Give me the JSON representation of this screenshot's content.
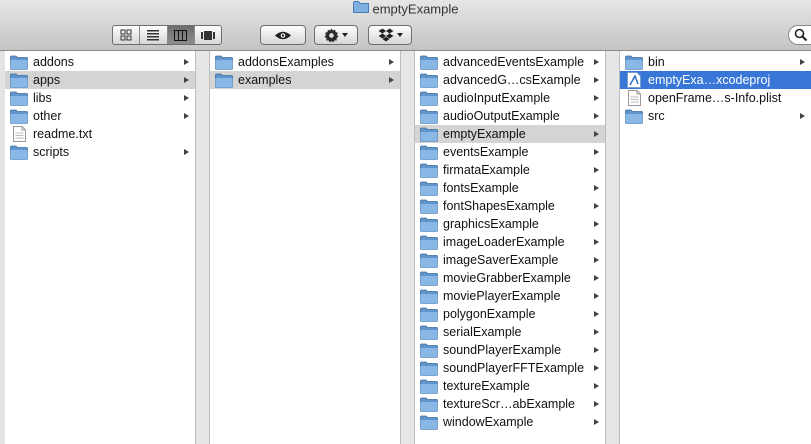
{
  "window": {
    "title": "emptyExample"
  },
  "toolbar": {
    "views": [
      {
        "name": "icon-view-button",
        "icon": "grid-icon"
      },
      {
        "name": "list-view-button",
        "icon": "list-icon"
      },
      {
        "name": "column-view-button",
        "icon": "columns-icon",
        "active": true
      },
      {
        "name": "coverflow-view-button",
        "icon": "coverflow-icon"
      }
    ]
  },
  "columns": [
    {
      "items": [
        {
          "label": "addons",
          "kind": "folder",
          "arrow": true
        },
        {
          "label": "apps",
          "kind": "folder",
          "arrow": true,
          "selected": "gray"
        },
        {
          "label": "libs",
          "kind": "folder",
          "arrow": true
        },
        {
          "label": "other",
          "kind": "folder",
          "arrow": true
        },
        {
          "label": "readme.txt",
          "kind": "file",
          "arrow": false
        },
        {
          "label": "scripts",
          "kind": "folder",
          "arrow": true
        }
      ]
    },
    {
      "items": [
        {
          "label": "addonsExamples",
          "kind": "folder",
          "arrow": true
        },
        {
          "label": "examples",
          "kind": "folder",
          "arrow": true,
          "selected": "gray"
        }
      ]
    },
    {
      "items": [
        {
          "label": "advancedEventsExample",
          "kind": "folder",
          "arrow": true
        },
        {
          "label": "advancedG…csExample",
          "kind": "folder",
          "arrow": true
        },
        {
          "label": "audioInputExample",
          "kind": "folder",
          "arrow": true
        },
        {
          "label": "audioOutputExample",
          "kind": "folder",
          "arrow": true
        },
        {
          "label": "emptyExample",
          "kind": "folder",
          "arrow": true,
          "selected": "gray"
        },
        {
          "label": "eventsExample",
          "kind": "folder",
          "arrow": true
        },
        {
          "label": "firmataExample",
          "kind": "folder",
          "arrow": true
        },
        {
          "label": "fontsExample",
          "kind": "folder",
          "arrow": true
        },
        {
          "label": "fontShapesExample",
          "kind": "folder",
          "arrow": true
        },
        {
          "label": "graphicsExample",
          "kind": "folder",
          "arrow": true
        },
        {
          "label": "imageLoaderExample",
          "kind": "folder",
          "arrow": true
        },
        {
          "label": "imageSaverExample",
          "kind": "folder",
          "arrow": true
        },
        {
          "label": "movieGrabberExample",
          "kind": "folder",
          "arrow": true
        },
        {
          "label": "moviePlayerExample",
          "kind": "folder",
          "arrow": true
        },
        {
          "label": "polygonExample",
          "kind": "folder",
          "arrow": true
        },
        {
          "label": "serialExample",
          "kind": "folder",
          "arrow": true
        },
        {
          "label": "soundPlayerExample",
          "kind": "folder",
          "arrow": true
        },
        {
          "label": "soundPlayerFFTExample",
          "kind": "folder",
          "arrow": true
        },
        {
          "label": "textureExample",
          "kind": "folder",
          "arrow": true
        },
        {
          "label": "textureScr…abExample",
          "kind": "folder",
          "arrow": true
        },
        {
          "label": "windowExample",
          "kind": "folder",
          "arrow": true
        }
      ]
    },
    {
      "items": [
        {
          "label": "bin",
          "kind": "folder",
          "arrow": true
        },
        {
          "label": "emptyExa…xcodeproj",
          "kind": "xcodeproj",
          "arrow": false,
          "selected": "blue"
        },
        {
          "label": "openFrame…s-Info.plist",
          "kind": "file",
          "arrow": false
        },
        {
          "label": "src",
          "kind": "folder",
          "arrow": true
        }
      ]
    }
  ],
  "colors": {
    "folder_blue": "#6ea2d8",
    "selection_gray": "#d4d4d4",
    "selection_blue": "#3876d8"
  }
}
